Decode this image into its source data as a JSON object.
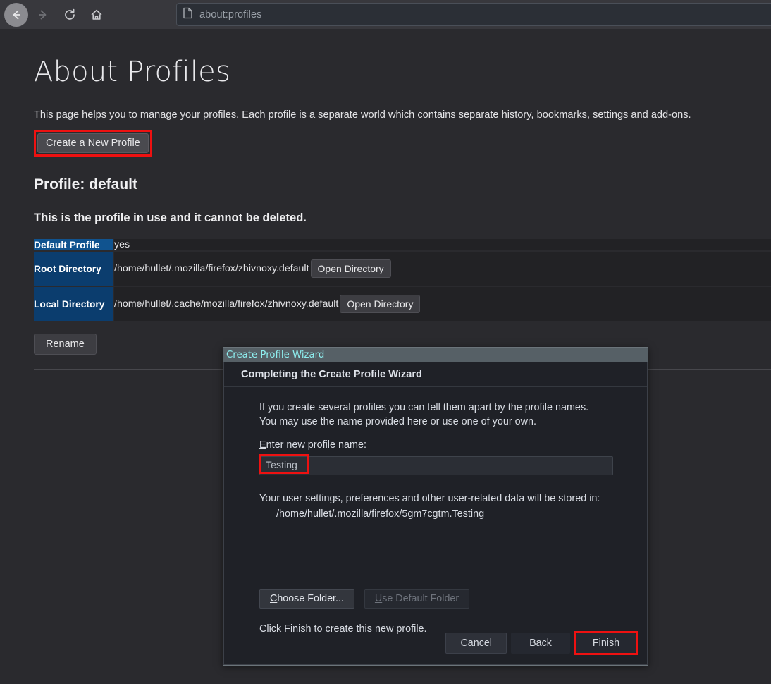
{
  "browser": {
    "back_icon": "arrow-left-icon",
    "forward_icon": "arrow-right-icon",
    "reload_icon": "reload-icon",
    "home_icon": "home-icon",
    "url_page_icon": "document-icon",
    "url": "about:profiles"
  },
  "page": {
    "title": "About Profiles",
    "intro": "This page helps you to manage your profiles. Each profile is a separate world which contains separate history, bookmarks, settings and add-ons.",
    "create_button": "Create a New Profile",
    "profile_heading": "Profile: default",
    "in_use_note": "This is the profile in use and it cannot be deleted.",
    "rename_button": "Rename",
    "table": {
      "rows": [
        {
          "header": "Default Profile",
          "value": "yes",
          "button": null
        },
        {
          "header": "Root Directory",
          "value": "/home/hullet/.mozilla/firefox/zhivnoxy.default",
          "button": "Open Directory"
        },
        {
          "header": "Local Directory",
          "value": "/home/hullet/.cache/mozilla/firefox/zhivnoxy.default",
          "button": "Open Directory"
        }
      ]
    }
  },
  "dialog": {
    "window_title": "Create Profile Wizard",
    "header": "Completing the Create Profile Wizard",
    "paragraph": "If you create several profiles you can tell them apart by the profile names. You may use the name provided here or use one of your own.",
    "field_label_accesskey": "E",
    "field_label_rest": "nter new profile name:",
    "profile_name_value": "Testing",
    "storage_note": "Your user settings, preferences and other user-related data will be stored in:",
    "storage_path": "/home/hullet/.mozilla/firefox/5gm7cgtm.Testing",
    "choose_folder_accesskey": "C",
    "choose_folder_rest": "hoose Folder...",
    "use_default_accesskey": "U",
    "use_default_rest": "se Default Folder",
    "finish_note": "Click Finish to create this new profile.",
    "cancel_button": "Cancel",
    "back_accesskey": "B",
    "back_rest": "ack",
    "finish_button": "Finish"
  },
  "colors": {
    "highlight": "#ee1111",
    "table_header_blue": "#0b3d6e",
    "table_header_blue_bright": "#10538f",
    "dialog_title_text": "#8eeff0",
    "page_bg": "#2a2a2e"
  }
}
